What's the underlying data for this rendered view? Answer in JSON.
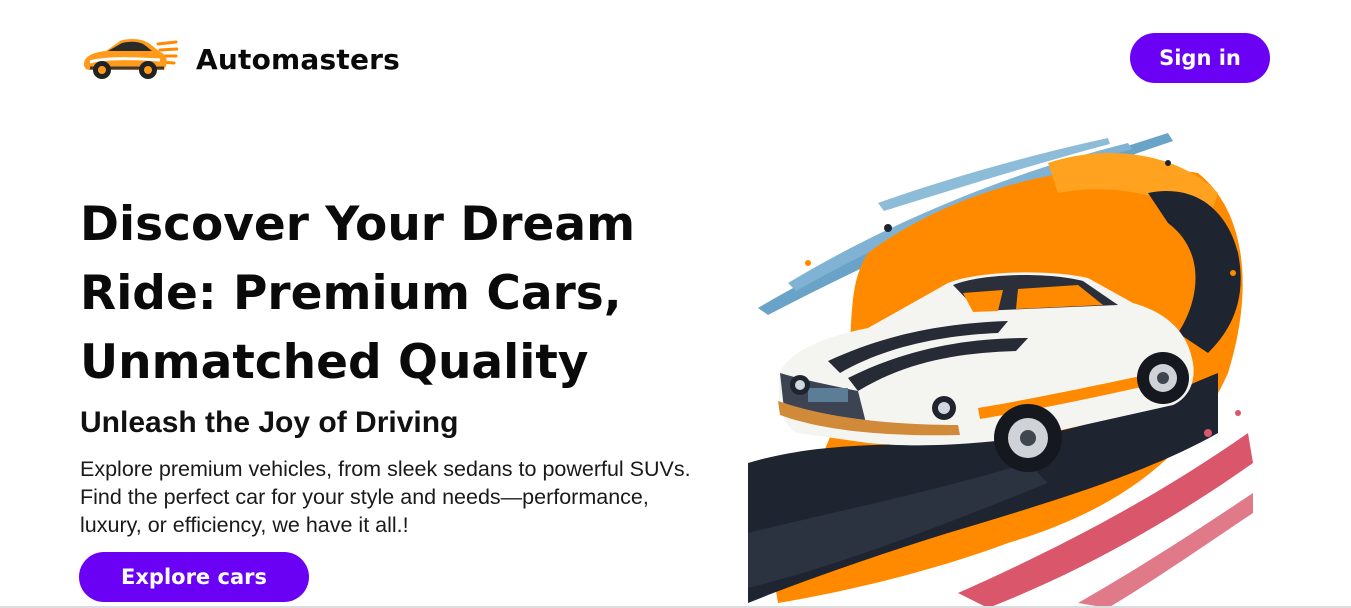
{
  "header": {
    "logo_icon": "car-logo-icon",
    "brand_name": "Automasters",
    "signin_label": "Sign in"
  },
  "hero": {
    "title": "Discover Your Dream Ride: Premium Cars, Unmatched Quality",
    "subtitle": "Unleash the Joy of Driving",
    "description": "Explore premium vehicles, from sleek sedans to powerful SUVs. Find the perfect car for your style and needs—performance, luxury, or efficiency, we have it all.!",
    "cta_label": "Explore cars",
    "image_icon": "muscle-car-illustration"
  },
  "colors": {
    "accent": "#6a00f4",
    "text": "#0a0a0a",
    "art_orange": "#ff8a00",
    "art_blue": "#6aa3c8",
    "art_pink": "#d9566b",
    "art_dark": "#1e2430"
  }
}
